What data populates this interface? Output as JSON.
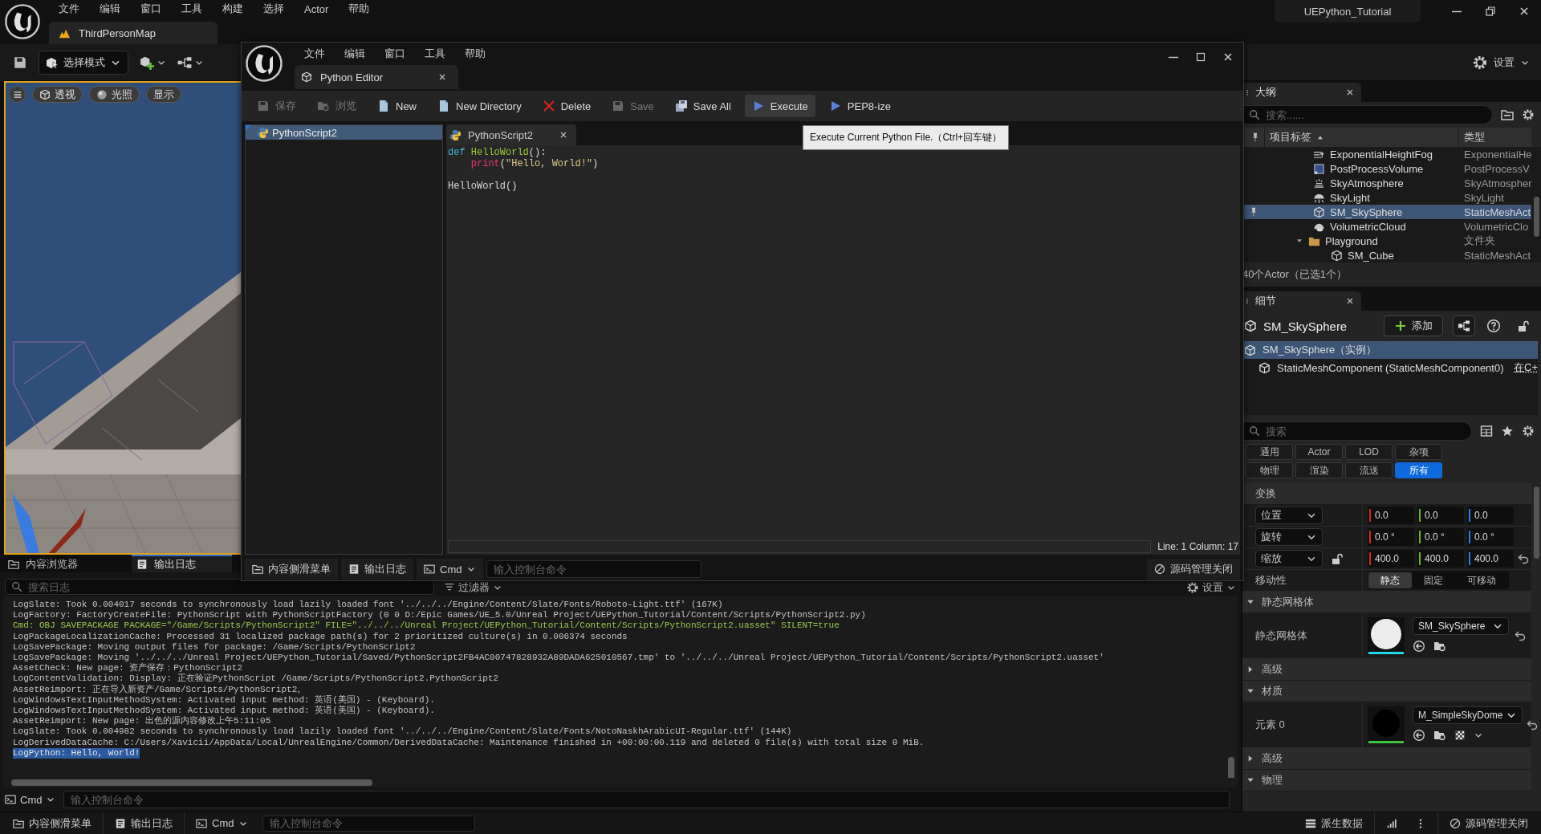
{
  "main_window": {
    "menu": [
      "文件",
      "编辑",
      "窗口",
      "工具",
      "构建",
      "选择",
      "Actor",
      "帮助"
    ],
    "project": "UEPython_Tutorial",
    "level_tab": "ThirdPersonMap"
  },
  "toolbar": {
    "mode": "选择模式",
    "settings": "设置"
  },
  "viewport": {
    "buttons": [
      {
        "label": "透视",
        "kind": "cube"
      },
      {
        "label": "光照",
        "kind": "sphere"
      },
      {
        "label": "显示",
        "kind": "text"
      }
    ]
  },
  "bottom_dock": {
    "tabs": [
      {
        "label": "内容浏览器",
        "kind": "folder",
        "selected": false
      },
      {
        "label": "输出日志",
        "kind": "log",
        "selected": true
      }
    ],
    "search_placeholder": "搜索日志",
    "filter": "过滤器",
    "settings": "设置",
    "lines": [
      {
        "text": "LogSlate: Took 0.004017 seconds to synchronously load lazily loaded font '../../../Engine/Content/Slate/Fonts/Roboto-Light.ttf' (167K)",
        "kind": "log",
        "selected": false
      },
      {
        "text": "LogFactory: FactoryCreateFile: PythonScript with PythonScriptFactory (0 0 D:/Epic Games/UE_5.0/Unreal Project/UEPython_Tutorial/Content/Scripts/PythonScript2.py)",
        "kind": "log",
        "selected": false
      },
      {
        "text": "Cmd: OBJ SAVEPACKAGE PACKAGE=\"/Game/Scripts/PythonScript2\" FILE=\"../../../Unreal Project/UEPython_Tutorial/Content/Scripts/PythonScript2.uasset\" SILENT=true",
        "kind": "command",
        "selected": false
      },
      {
        "text": "LogPackageLocalizationCache: Processed 31 localized package path(s) for 2 prioritized culture(s) in 0.006374 seconds",
        "kind": "log",
        "selected": false
      },
      {
        "text": "LogSavePackage: Moving output files for package: /Game/Scripts/PythonScript2",
        "kind": "log",
        "selected": false
      },
      {
        "text": "LogSavePackage: Moving '../../../Unreal Project/UEPython_Tutorial/Saved/PythonScript2FB4AC00747828932A89DADA625010567.tmp' to '../../../Unreal Project/UEPython_Tutorial/Content/Scripts/PythonScript2.uasset'",
        "kind": "log",
        "selected": false
      },
      {
        "text": "AssetCheck: New page: 资产保存：PythonScript2",
        "kind": "log",
        "selected": false
      },
      {
        "text": "LogContentValidation: Display: 正在验证PythonScript /Game/Scripts/PythonScript2.PythonScript2",
        "kind": "log",
        "selected": false
      },
      {
        "text": "AssetReimport: 正在导入新资产/Game/Scripts/PythonScript2。",
        "kind": "log",
        "selected": false
      },
      {
        "text": "LogWindowsTextInputMethodSystem: Activated input method: 英语(美国) - (Keyboard).",
        "kind": "log",
        "selected": false
      },
      {
        "text": "LogWindowsTextInputMethodSystem: Activated input method: 英语(美国) - (Keyboard).",
        "kind": "log",
        "selected": false
      },
      {
        "text": "AssetReimport: New page: 出色的源内容修改上午5:11:05",
        "kind": "log",
        "selected": false
      },
      {
        "text": "LogSlate: Took 0.004982 seconds to synchronously load lazily loaded font '../../../Engine/Content/Slate/Fonts/NotoNaskhArabicUI-Regular.ttf' (144K)",
        "kind": "log",
        "selected": false
      },
      {
        "text": "LogDerivedDataCache: C:/Users/Xavicii/AppData/Local/UnrealEngine/Common/DerivedDataCache: Maintenance finished in +00:00:00.119 and deleted 0 file(s) with total size 0 MiB.",
        "kind": "log",
        "selected": false
      },
      {
        "text": "LogPython: Hello, World!",
        "kind": "log",
        "selected": true
      }
    ],
    "cmd": "Cmd",
    "cmd_placeholder": "输入控制台命令"
  },
  "status_bar": {
    "drawer": "内容侧滑菜单",
    "output_log": "输出日志",
    "cmd": "Cmd",
    "cmd_placeholder": "输入控制台命令",
    "derived_data": "派生数据",
    "source_control": "源码管理关闭"
  },
  "outliner": {
    "title": "大纲",
    "search_placeholder": "搜索......",
    "columns": [
      "项目标签",
      "类型"
    ],
    "rows": [
      {
        "label": "ExponentialHeightFog",
        "type": "ExponentialHe",
        "kind": "fog",
        "selected": false,
        "pinned": false
      },
      {
        "label": "PostProcessVolume",
        "type": "PostProcessV",
        "kind": "volume",
        "selected": false,
        "pinned": false
      },
      {
        "label": "SkyAtmosphere",
        "type": "SkyAtmospher",
        "kind": "atmosphere",
        "selected": false,
        "pinned": false
      },
      {
        "label": "SkyLight",
        "type": "SkyLight",
        "kind": "light",
        "selected": false,
        "pinned": false
      },
      {
        "label": "SM_SkySphere",
        "type": "StaticMeshAct",
        "kind": "mesh",
        "selected": true,
        "pinned": true
      },
      {
        "label": "VolumetricCloud",
        "type": "VolumetricClo",
        "kind": "cloud",
        "selected": false,
        "pinned": false
      },
      {
        "label": "Playground",
        "type": "文件夹",
        "kind": "folder",
        "expanded": true,
        "selected": false,
        "pinned": false,
        "children": [
          {
            "label": "SM_Cube",
            "type": "StaticMeshAct",
            "kind": "mesh",
            "selected": false,
            "pinned": false
          }
        ]
      }
    ],
    "count": "40个Actor（已选1个）"
  },
  "details": {
    "title": "细节",
    "object": "SM_SkySphere",
    "add": "添加",
    "components": [
      {
        "label": "SM_SkySphere（实例）",
        "selected": true,
        "children": [
          {
            "label": "StaticMeshComponent (StaticMeshComponent0)",
            "link": "在C+",
            "selected": false
          }
        ]
      }
    ],
    "search_placeholder": "搜索",
    "filters": [
      {
        "label": "通用",
        "selected": false
      },
      {
        "label": "Actor",
        "selected": false
      },
      {
        "label": "LOD",
        "selected": false
      },
      {
        "label": "杂项",
        "selected": false
      },
      {
        "label": "物理",
        "selected": false
      },
      {
        "label": "渲染",
        "selected": false
      },
      {
        "label": "流送",
        "selected": false
      },
      {
        "label": "所有",
        "selected": true
      }
    ],
    "transform": {
      "title": "变换",
      "rows": [
        {
          "label": "位置",
          "values": [
            "0.0",
            "0.0",
            "0.0"
          ],
          "lock": false,
          "resettable": false
        },
        {
          "label": "旋转",
          "values": [
            "0.0 °",
            "0.0 °",
            "0.0 °"
          ],
          "lock": false,
          "resettable": false
        },
        {
          "label": "缩放",
          "values": [
            "400.0",
            "400.0",
            "400.0"
          ],
          "lock": true,
          "resettable": true
        }
      ]
    },
    "mobility": {
      "label": "移动性",
      "options": [
        {
          "label": "静态",
          "selected": true
        },
        {
          "label": "固定",
          "selected": false
        },
        {
          "label": "可移动",
          "selected": false
        }
      ]
    },
    "sections": [
      {
        "title": "静态网格体",
        "expanded": true,
        "rows": [
          {
            "label": "静态网格体",
            "asset": "SM_SkySphere",
            "kind": "mesh"
          }
        ]
      },
      {
        "title": "高级",
        "expanded": false
      },
      {
        "title": "材质",
        "expanded": true,
        "rows": [
          {
            "label": "元素 0",
            "asset": "M_SimpleSkyDome",
            "kind": "material"
          }
        ]
      },
      {
        "title": "高级",
        "expanded": false
      },
      {
        "title": "物理",
        "expanded": true
      }
    ]
  },
  "python_editor": {
    "menu": [
      "文件",
      "编辑",
      "窗口",
      "工具",
      "帮助"
    ],
    "tab": "Python Editor",
    "toolbar": [
      {
        "label": "保存",
        "kind": "save",
        "disabled": true,
        "highlighted": false
      },
      {
        "label": "浏览",
        "kind": "browse",
        "disabled": true,
        "highlighted": false
      },
      {
        "label": "New",
        "kind": "file",
        "disabled": false,
        "highlighted": false
      },
      {
        "label": "New Directory",
        "kind": "file",
        "disabled": false,
        "highlighted": false
      },
      {
        "label": "Delete",
        "kind": "delete",
        "disabled": false,
        "highlighted": false
      },
      {
        "label": "Save",
        "kind": "save",
        "disabled": true,
        "highlighted": false
      },
      {
        "label": "Save All",
        "kind": "saveall",
        "disabled": false,
        "highlighted": false
      },
      {
        "label": "Execute",
        "kind": "play",
        "disabled": false,
        "highlighted": true
      },
      {
        "label": "PEP8-ize",
        "kind": "play",
        "disabled": false,
        "highlighted": false
      }
    ],
    "tooltip": "Execute Current Python File.（Ctrl+回车键）",
    "files": [
      {
        "label": "PythonScript2",
        "selected": true
      }
    ],
    "open_tab": "PythonScript2",
    "code": [
      {
        "kind": "code",
        "tokens": [
          {
            "text": "def ",
            "kind": "keyword"
          },
          {
            "text": "HelloWorld",
            "kind": "function"
          },
          {
            "text": "():",
            "kind": "plain"
          }
        ]
      },
      {
        "kind": "code",
        "tokens": [
          {
            "text": "    print",
            "kind": "builtin"
          },
          {
            "text": "(",
            "kind": "plain"
          },
          {
            "text": "\"Hello, World!\"",
            "kind": "string"
          },
          {
            "text": ")",
            "kind": "plain"
          }
        ]
      },
      {
        "kind": "blank"
      },
      {
        "kind": "code",
        "tokens": [
          {
            "text": "HelloWorld()",
            "kind": "plain"
          }
        ]
      }
    ],
    "cursor": "Line: 1 Column: 17",
    "bottom_bar": {
      "drawer": "内容侧滑菜单",
      "output_log": "输出日志",
      "cmd": "Cmd",
      "cmd_placeholder": "输入控制台命令",
      "source_control": "源码管理关闭"
    }
  }
}
